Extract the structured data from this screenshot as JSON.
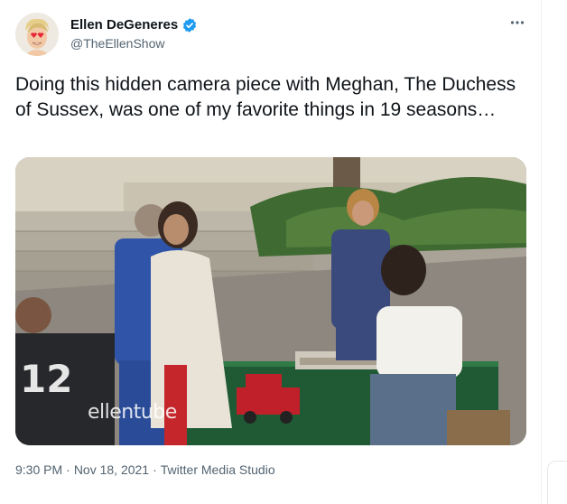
{
  "author": {
    "display_name": "Ellen DeGeneres",
    "handle": "@TheEllenShow",
    "avatar_icon": "ellen-heart-eyes-avatar",
    "verified_icon": "verified-badge-icon",
    "verified_color": "#1d9bf0"
  },
  "tweet": {
    "text": "Doing this hidden camera piece with Meghan, The Duchess of Sussex, was one of my favorite things in 19 seasons…",
    "media_watermark": "ellentube",
    "time": "9:30 PM",
    "separator": "·",
    "date": "Nov 18, 2021",
    "source": "Twitter Media Studio"
  },
  "menu": {
    "more_icon": "more-horizontal-icon"
  },
  "colors": {
    "text_primary": "#0f1419",
    "text_secondary": "#536471"
  }
}
